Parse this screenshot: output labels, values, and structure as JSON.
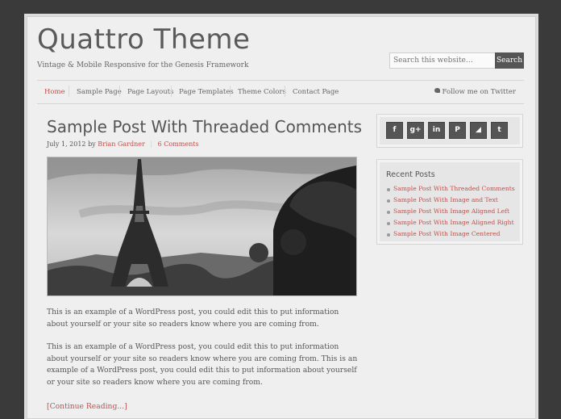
{
  "site": {
    "title": "Quattro Theme",
    "tagline": "Vintage & Mobile Responsive for the Genesis Framework"
  },
  "search": {
    "placeholder": "Search this website…",
    "button_label": "Search"
  },
  "nav": {
    "items": [
      "Home",
      "Sample Page",
      "Page Layouts",
      "Page Templates",
      "Theme Colors",
      "Contact Page"
    ],
    "active": "Home",
    "twitter_label": "Follow me on Twitter"
  },
  "post": {
    "title": "Sample Post With Threaded Comments",
    "date": "July 1, 2012",
    "by": "by",
    "author": "Brian Gardner",
    "comments": "6 Comments",
    "image_alt": "Eiffel Tower",
    "paragraph1": "This is an example of a WordPress post, you could edit this to put information about yourself or your site so readers know where you are coming from.",
    "paragraph2": "This is an example of a WordPress post, you could edit this to put information about yourself or your site so readers know where you are coming from. This is an example of a WordPress post, you could edit this to put information about yourself or your site so readers know where you are coming from.",
    "continue_label": "[Continue Reading...]"
  },
  "sidebar": {
    "social_icons": [
      {
        "name": "facebook-icon",
        "glyph": "f"
      },
      {
        "name": "google-plus-icon",
        "glyph": "g+"
      },
      {
        "name": "linkedin-icon",
        "glyph": "in"
      },
      {
        "name": "pinterest-icon",
        "glyph": "P"
      },
      {
        "name": "rss-icon",
        "glyph": "◢"
      },
      {
        "name": "twitter-icon",
        "glyph": "t"
      }
    ],
    "recent_title": "Recent Posts",
    "recent_posts": [
      "Sample Post With Threaded Comments",
      "Sample Post With Image and Text",
      "Sample Post With Image Aligned Left",
      "Sample Post With Image Aligned Right",
      "Sample Post With Image Centered"
    ]
  },
  "colors": {
    "accent": "#c0504d",
    "text": "#555555",
    "background": "#efefef",
    "outer": "#3a3a3a"
  }
}
